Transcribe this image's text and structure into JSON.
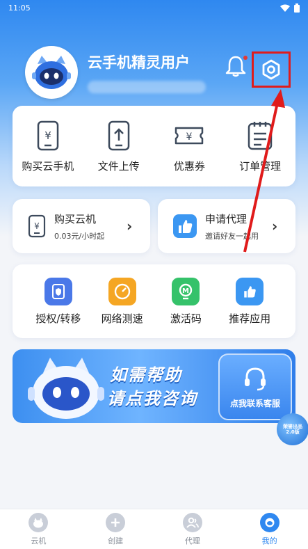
{
  "status_bar": {
    "time": "11:05"
  },
  "profile": {
    "username": "云手机精灵用户"
  },
  "services": [
    {
      "label": "购买云手机",
      "icon": "phone-yuan-icon"
    },
    {
      "label": "文件上传",
      "icon": "upload-icon"
    },
    {
      "label": "优惠券",
      "icon": "coupon-icon"
    },
    {
      "label": "订单管理",
      "icon": "order-icon"
    }
  ],
  "buy_card": {
    "title": "购买云机",
    "subtitle": "0.03元/小时起"
  },
  "agent_card": {
    "title": "申请代理",
    "subtitle": "邀请好友一起用"
  },
  "tools": [
    {
      "label": "授权/转移",
      "color": "#4a78e8"
    },
    {
      "label": "网络测速",
      "color": "#f5a623"
    },
    {
      "label": "激活码",
      "color": "#35c26a"
    },
    {
      "label": "推荐应用",
      "color": "#3b97f2"
    }
  ],
  "banner": {
    "line1": "如需帮助",
    "line2": "请点我咨询",
    "contact": "点我联系客服"
  },
  "float_badge": {
    "line1": "荣誉出品",
    "line2": "2.0版"
  },
  "tabs": [
    {
      "label": "云机",
      "active": false
    },
    {
      "label": "创建",
      "active": false
    },
    {
      "label": "代理",
      "active": false
    },
    {
      "label": "我的",
      "active": true
    }
  ],
  "colors": {
    "primary": "#2f88f0",
    "annotation_red": "#e01b1b"
  }
}
